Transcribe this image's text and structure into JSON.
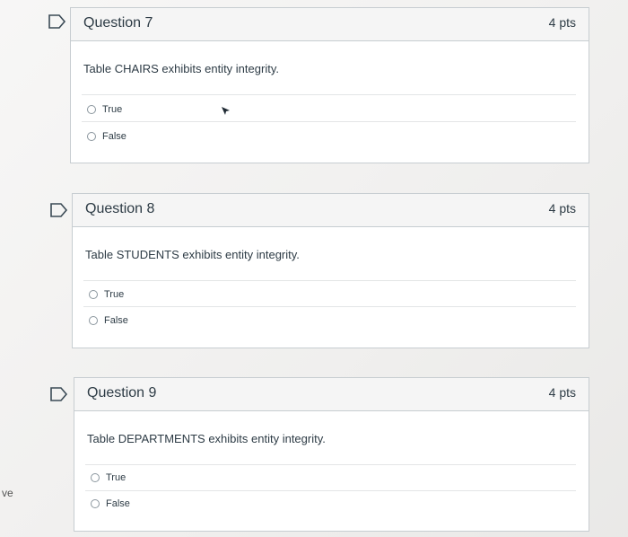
{
  "edge_text": "ve",
  "questions": [
    {
      "title": "Question 7",
      "points": "4 pts",
      "text": "Table CHAIRS exhibits entity integrity.",
      "answers": [
        "True",
        "False"
      ]
    },
    {
      "title": "Question 8",
      "points": "4 pts",
      "text": "Table STUDENTS exhibits entity integrity.",
      "answers": [
        "True",
        "False"
      ]
    },
    {
      "title": "Question 9",
      "points": "4 pts",
      "text": "Table DEPARTMENTS exhibits entity integrity.",
      "answers": [
        "True",
        "False"
      ]
    }
  ],
  "icons": {
    "flag": "flag-outline-icon",
    "cursor": "mouse-pointer-icon"
  },
  "colors": {
    "header_bg": "#f5f5f5",
    "border": "#c7cdd1",
    "text": "#2d3b45",
    "flag": "#2d3b45"
  }
}
